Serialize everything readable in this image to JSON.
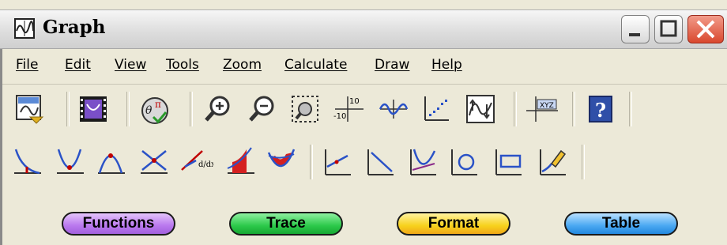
{
  "window": {
    "title": "Graph"
  },
  "menubar": {
    "items": [
      {
        "label": "File"
      },
      {
        "label": "Edit"
      },
      {
        "label": "View"
      },
      {
        "label": "Tools"
      },
      {
        "label": "Zoom"
      },
      {
        "label": "Calculate"
      },
      {
        "label": "Draw"
      },
      {
        "label": "Help"
      }
    ]
  },
  "toolbar1": {
    "icons": [
      "open-graph-icon",
      "video-icon",
      "theta-pi-settings-icon",
      "zoom-in-icon",
      "zoom-out-icon",
      "zoom-box-icon",
      "axes-range-icon",
      "sine-wave-icon",
      "scatter-plot-icon",
      "trace-graph-icon",
      "xyz-coordinates-icon",
      "help-icon"
    ],
    "axes_top": "10",
    "axes_bottom": "-10",
    "xyz_label": "XYZ",
    "help_label": "?"
  },
  "toolbar2": {
    "icons": [
      "zero-icon",
      "minimum-icon",
      "maximum-icon",
      "intersection-icon",
      "derivative-icon",
      "integral-icon",
      "area-between-icon",
      "line-segment-icon",
      "tangent-line-icon",
      "normal-line-icon",
      "circle-icon",
      "rectangle-icon",
      "pencil-draw-icon"
    ],
    "derivative_label": "d/dx"
  },
  "buttons": {
    "functions": "Functions",
    "trace": "Trace",
    "format": "Format",
    "table": "Table"
  },
  "colors": {
    "functions": "#c58cf0",
    "trace": "#2cc94a",
    "format": "#f7d21c",
    "table": "#4aa8f2",
    "close": "#d9482e",
    "accent_red": "#cc0000"
  }
}
